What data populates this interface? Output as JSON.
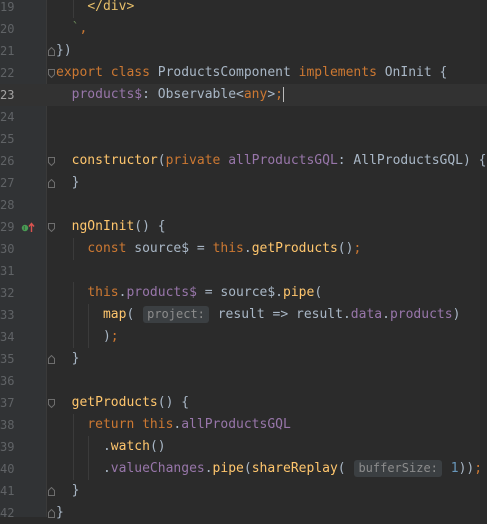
{
  "editor": {
    "lines": [
      {
        "n": "19",
        "indent": 4,
        "segs": [
          [
            "tag",
            "</div>"
          ]
        ]
      },
      {
        "n": "20",
        "indent": 2,
        "segs": [
          [
            "str",
            "`"
          ],
          [
            "kw",
            ","
          ]
        ]
      },
      {
        "n": "21",
        "indent": 0,
        "segs": [
          [
            "plain",
            "})"
          ]
        ]
      },
      {
        "n": "22",
        "indent": 0,
        "segs": [
          [
            "kw",
            "export class "
          ],
          [
            "plain",
            "ProductsComponent "
          ],
          [
            "kw",
            "implements "
          ],
          [
            "plain",
            "OnInit {"
          ]
        ]
      },
      {
        "n": "23",
        "indent": 2,
        "current": true,
        "segs": [
          [
            "field",
            "products$"
          ],
          [
            "plain",
            ": Observable<"
          ],
          [
            "kw",
            "any"
          ],
          [
            "plain",
            ">"
          ],
          [
            "kw",
            ";"
          ]
        ]
      },
      {
        "n": "24",
        "indent": 0,
        "segs": []
      },
      {
        "n": "25",
        "indent": 0,
        "segs": []
      },
      {
        "n": "26",
        "indent": 2,
        "segs": [
          [
            "fn",
            "constructor"
          ],
          [
            "plain",
            "("
          ],
          [
            "kw",
            "private "
          ],
          [
            "field",
            "allProductsGQL"
          ],
          [
            "plain",
            ": AllProductsGQL) {"
          ]
        ]
      },
      {
        "n": "27",
        "indent": 2,
        "segs": [
          [
            "plain",
            "}"
          ]
        ]
      },
      {
        "n": "28",
        "indent": 0,
        "segs": []
      },
      {
        "n": "29",
        "indent": 2,
        "segs": [
          [
            "fn",
            "ngOnInit"
          ],
          [
            "plain",
            "() {"
          ]
        ]
      },
      {
        "n": "30",
        "indent": 4,
        "segs": [
          [
            "kw",
            "const "
          ],
          [
            "plain",
            "source$ = "
          ],
          [
            "kw",
            "this"
          ],
          [
            "plain",
            "."
          ],
          [
            "fn",
            "getProducts"
          ],
          [
            "plain",
            "()"
          ],
          [
            "kw",
            ";"
          ]
        ]
      },
      {
        "n": "31",
        "indent": 0,
        "segs": []
      },
      {
        "n": "32",
        "indent": 4,
        "segs": [
          [
            "kw",
            "this"
          ],
          [
            "plain",
            "."
          ],
          [
            "field",
            "products$"
          ],
          [
            "plain",
            " = source$."
          ],
          [
            "fn",
            "pipe"
          ],
          [
            "plain",
            "("
          ]
        ]
      },
      {
        "n": "33",
        "indent": 6,
        "segs": [
          [
            "fn",
            "map"
          ],
          [
            "plain",
            "( "
          ],
          [
            "hint",
            "project:"
          ],
          [
            "plain",
            " result => result."
          ],
          [
            "field",
            "data"
          ],
          [
            "plain",
            "."
          ],
          [
            "field",
            "products"
          ],
          [
            "plain",
            ")"
          ]
        ]
      },
      {
        "n": "34",
        "indent": 6,
        "segs": [
          [
            "plain",
            ")"
          ],
          [
            "kw",
            ";"
          ]
        ]
      },
      {
        "n": "35",
        "indent": 2,
        "segs": [
          [
            "plain",
            "}"
          ]
        ]
      },
      {
        "n": "36",
        "indent": 0,
        "segs": []
      },
      {
        "n": "37",
        "indent": 2,
        "segs": [
          [
            "fn",
            "getProducts"
          ],
          [
            "plain",
            "() {"
          ]
        ]
      },
      {
        "n": "38",
        "indent": 4,
        "segs": [
          [
            "kw",
            "return this"
          ],
          [
            "plain",
            "."
          ],
          [
            "field",
            "allProductsGQL"
          ]
        ]
      },
      {
        "n": "39",
        "indent": 6,
        "segs": [
          [
            "plain",
            "."
          ],
          [
            "fn",
            "watch"
          ],
          [
            "plain",
            "()"
          ]
        ]
      },
      {
        "n": "40",
        "indent": 6,
        "segs": [
          [
            "plain",
            "."
          ],
          [
            "field",
            "valueChanges"
          ],
          [
            "plain",
            "."
          ],
          [
            "fn",
            "pipe"
          ],
          [
            "plain",
            "("
          ],
          [
            "fn",
            "shareReplay"
          ],
          [
            "plain",
            "( "
          ],
          [
            "hint",
            "bufferSize:"
          ],
          [
            "plain",
            " "
          ],
          [
            "num",
            "1"
          ],
          [
            "plain",
            "))"
          ],
          [
            "kw",
            ";"
          ]
        ]
      },
      {
        "n": "41",
        "indent": 2,
        "segs": [
          [
            "plain",
            "}"
          ]
        ]
      },
      {
        "n": "42",
        "indent": 0,
        "segs": [
          [
            "plain",
            "}"
          ]
        ]
      }
    ],
    "colors": {
      "background": "#2b2b2b",
      "keyword": "#cc7832",
      "function": "#ffc66d",
      "field": "#9876aa",
      "string": "#6a8759",
      "number": "#6897bb",
      "tag": "#e8bf6a",
      "text": "#a9b7c6"
    },
    "gutter_icons": {
      "29": "implements-method-icon"
    }
  }
}
